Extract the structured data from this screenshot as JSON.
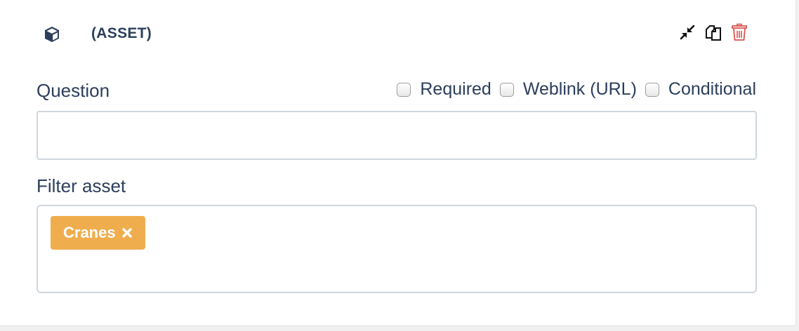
{
  "header": {
    "title": "(ASSET)",
    "icon": "cube-icon",
    "actions": [
      {
        "name": "collapse-icon"
      },
      {
        "name": "copy-icon"
      },
      {
        "name": "trash-icon",
        "color": "#d9534f"
      }
    ]
  },
  "question": {
    "label": "Question",
    "value": "",
    "placeholder": ""
  },
  "options": {
    "required_label": "Required",
    "weblink_label": "Weblink (URL)",
    "conditional_label": "Conditional"
  },
  "filter": {
    "label": "Filter asset",
    "tags": [
      {
        "label": "Cranes",
        "color": "#f0ad4e"
      }
    ]
  },
  "colors": {
    "text": "#2c3e5c",
    "tag": "#f0ad4e",
    "delete": "#d9534f"
  }
}
